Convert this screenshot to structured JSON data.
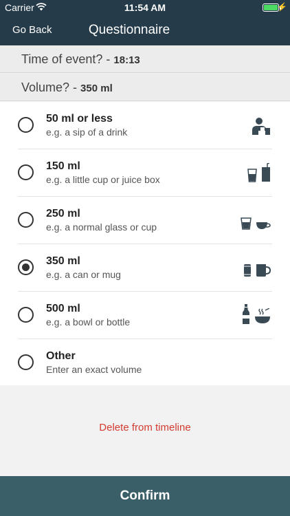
{
  "status_bar": {
    "carrier": "Carrier",
    "time": "11:54 AM"
  },
  "nav": {
    "back_label": "Go Back",
    "title": "Questionnaire"
  },
  "time_row": {
    "label": "Time of event? - ",
    "value": "18:13"
  },
  "volume_row": {
    "label": "Volume? - ",
    "value": "350 ml"
  },
  "options": [
    {
      "label": "50 ml or less",
      "sub": "e.g. a sip of a drink",
      "selected": false,
      "icons": [
        "person-sipping-icon"
      ]
    },
    {
      "label": "150 ml",
      "sub": "e.g. a little cup or juice box",
      "selected": false,
      "icons": [
        "small-cup-icon",
        "juice-box-icon"
      ]
    },
    {
      "label": "250 ml",
      "sub": "e.g. a normal glass or cup",
      "selected": false,
      "icons": [
        "glass-icon",
        "teacup-icon"
      ]
    },
    {
      "label": "350 ml",
      "sub": "e.g. a can or mug",
      "selected": true,
      "icons": [
        "can-icon",
        "mug-icon"
      ]
    },
    {
      "label": "500 ml",
      "sub": "e.g. a bowl or bottle",
      "selected": false,
      "icons": [
        "bottle-icon",
        "soup-bowl-icon"
      ]
    },
    {
      "label": "Other",
      "sub": "Enter an exact volume",
      "selected": false,
      "icons": []
    }
  ],
  "delete_label": "Delete from timeline",
  "confirm_label": "Confirm",
  "colors": {
    "navbar": "#253b4a",
    "confirm": "#3b5f68",
    "delete": "#d33b2f",
    "icon": "#3a4a55"
  }
}
